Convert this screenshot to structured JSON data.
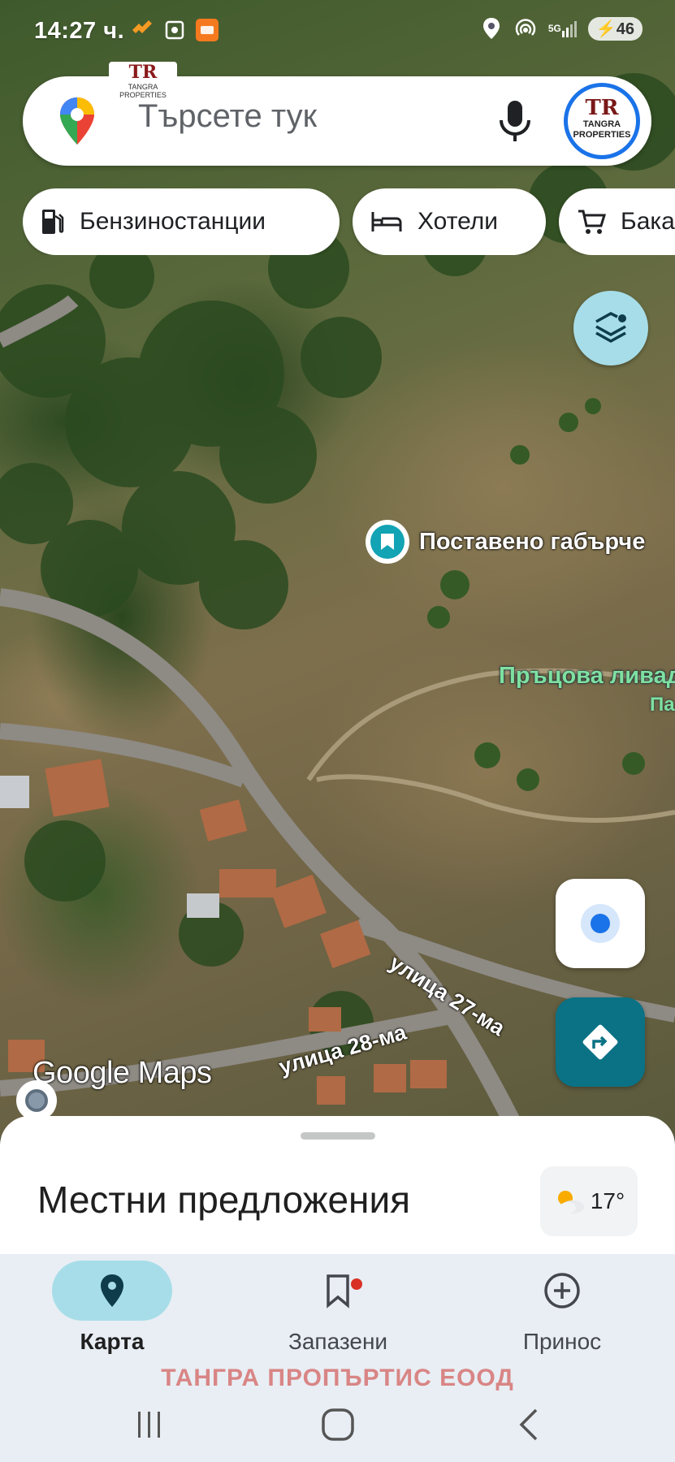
{
  "status_bar": {
    "time": "14:27 ч.",
    "battery": "46",
    "network": "5G"
  },
  "watermark": {
    "logo_initials": "TR",
    "logo_text": "TANGRA PROPERTIES",
    "company_name": "ТАНГРА ПРОПЪРТИС  ЕООД"
  },
  "search": {
    "placeholder": "Търсете тук",
    "avatar_initials": "TR",
    "avatar_text": "TANGRA PROPERTIES"
  },
  "chips": [
    {
      "label": "Бензиностанции",
      "icon": "gas-station-icon"
    },
    {
      "label": "Хотели",
      "icon": "hotel-bed-icon"
    },
    {
      "label": "Бака",
      "icon": "shopping-cart-icon"
    }
  ],
  "map": {
    "saved_place_label": "Поставено габърче",
    "area_label": "Пръцова ливад",
    "area_label_2": "Па",
    "street_1": "улица 27-ма",
    "street_2": "улица 28-ма",
    "attribution": "Google Maps"
  },
  "sheet": {
    "title": "Местни предложения",
    "temperature": "17°",
    "weather_icon": "partly-cloudy-icon"
  },
  "bottom_nav": [
    {
      "label": "Карта",
      "icon": "map-pin-icon",
      "active": true
    },
    {
      "label": "Запазени",
      "icon": "bookmark-icon",
      "active": false
    },
    {
      "label": "Принос",
      "icon": "add-circle-icon",
      "active": false
    }
  ],
  "colors": {
    "accent_teal": "#0b7285",
    "active_pill": "#a7dde8",
    "location_blue": "#1a73e8",
    "company_text": "#d98585"
  }
}
